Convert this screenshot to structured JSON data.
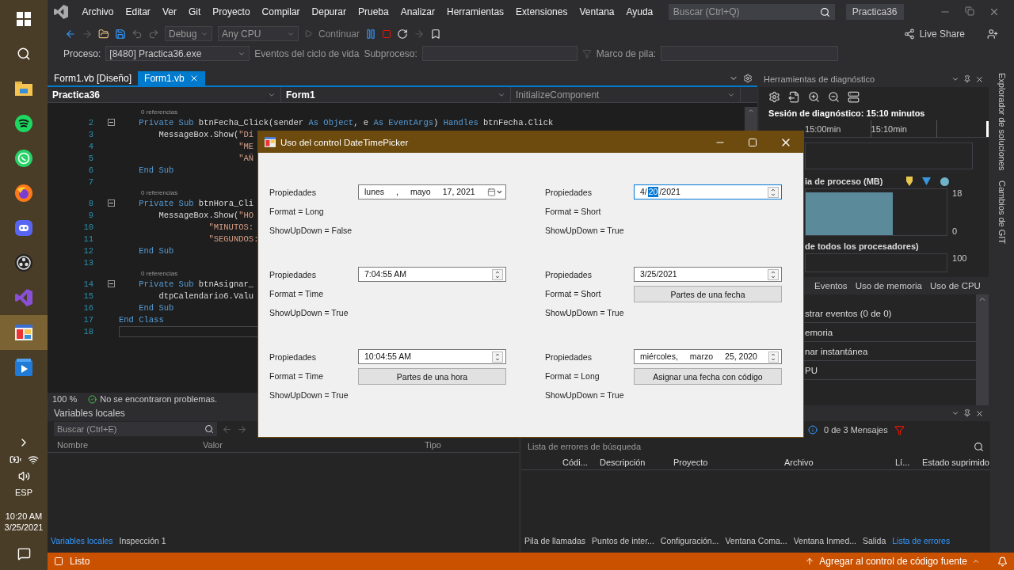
{
  "taskbar": {
    "apps": [
      {
        "kind": "start",
        "selected": false
      },
      {
        "kind": "search",
        "selected": false
      },
      {
        "kind": "folder",
        "selected": false
      },
      {
        "kind": "music",
        "selected": false
      },
      {
        "kind": "chat",
        "selected": false
      },
      {
        "kind": "browser",
        "selected": false
      },
      {
        "kind": "voice",
        "selected": false
      },
      {
        "kind": "recorder",
        "selected": false
      },
      {
        "kind": "ide",
        "selected": false
      },
      {
        "kind": "form-app",
        "selected": true
      },
      {
        "kind": "player",
        "selected": false
      }
    ],
    "language": "ESP",
    "time": "10:20 AM",
    "date": "3/25/2021"
  },
  "menu": [
    "Archivo",
    "Editar",
    "Ver",
    "Git",
    "Proyecto",
    "Compilar",
    "Depurar",
    "Prueba",
    "Analizar",
    "Herramientas",
    "Extensiones",
    "Ventana",
    "Ayuda"
  ],
  "search": {
    "placeholder": "Buscar (Ctrl+Q)"
  },
  "solution_name": "Practica36",
  "toolbar": {
    "configuration": "Debug",
    "platform": "Any CPU",
    "continue": "Continuar",
    "live_share": "Live Share"
  },
  "process_bar": {
    "label": "Proceso:",
    "process": "[8480] Practica36.exe",
    "lifecycle": "Eventos del ciclo de vida",
    "thread_label": "Subproceso:",
    "stack_label": "Marco de pila:"
  },
  "doc_tabs": [
    {
      "label": "Form1.vb [Diseño]",
      "selected": false
    },
    {
      "label": "Form1.vb",
      "selected": true
    }
  ],
  "nav_bar": {
    "project": "Practica36",
    "type": "Form1",
    "member": "InitializeComponent"
  },
  "code_lines": [
    {
      "kind": "lens",
      "text": "0 referencias",
      "fold": false,
      "current": false
    },
    {
      "kind": "code",
      "n": "2",
      "fold": true,
      "current": false,
      "tokens": [
        {
          "text": "    Private Sub ",
          "kind": "kw"
        },
        {
          "text": "btnFecha_Click(sender ",
          "kind": "p"
        },
        {
          "text": "As Object",
          "kind": "kw"
        },
        {
          "text": ", e ",
          "kind": "p"
        },
        {
          "text": "As EventArgs",
          "kind": "kw"
        },
        {
          "text": ") ",
          "kind": "p"
        },
        {
          "text": "Handles",
          "kind": "kw"
        },
        {
          "text": " btnFecha.Click",
          "kind": "p"
        }
      ]
    },
    {
      "kind": "code",
      "n": "3",
      "fold": false,
      "current": false,
      "tokens": [
        {
          "text": "        MessageBox.Show(",
          "kind": "p"
        },
        {
          "text": "\"Dí",
          "kind": "str"
        }
      ]
    },
    {
      "kind": "code",
      "n": "4",
      "fold": false,
      "current": false,
      "tokens": [
        {
          "text": "                        \"ME",
          "kind": "str"
        }
      ]
    },
    {
      "kind": "code",
      "n": "5",
      "fold": false,
      "current": false,
      "tokens": [
        {
          "text": "                        \"AÑ",
          "kind": "str"
        }
      ]
    },
    {
      "kind": "code",
      "n": "6",
      "fold": false,
      "current": false,
      "tokens": [
        {
          "text": "    End Sub",
          "kind": "kw"
        }
      ]
    },
    {
      "kind": "code",
      "n": "7",
      "fold": false,
      "current": false
    },
    {
      "kind": "lens",
      "text": "0 referencias",
      "fold": false,
      "current": false
    },
    {
      "kind": "code",
      "n": "8",
      "fold": true,
      "current": false,
      "tokens": [
        {
          "text": "    Private Sub ",
          "kind": "kw"
        },
        {
          "text": "btnHora_Cli",
          "kind": "p"
        }
      ]
    },
    {
      "kind": "code",
      "n": "9",
      "fold": false,
      "current": false,
      "tokens": [
        {
          "text": "        MessageBox.Show(",
          "kind": "p"
        },
        {
          "text": "\"HO",
          "kind": "str"
        }
      ]
    },
    {
      "kind": "code",
      "n": "10",
      "fold": false,
      "current": false,
      "tokens": [
        {
          "text": "                  \"MINUTOS:",
          "kind": "str"
        }
      ]
    },
    {
      "kind": "code",
      "n": "11",
      "fold": false,
      "current": false,
      "tokens": [
        {
          "text": "                  \"SEGUNDOS:",
          "kind": "str"
        }
      ]
    },
    {
      "kind": "code",
      "n": "12",
      "fold": false,
      "current": false,
      "tokens": [
        {
          "text": "    End Sub",
          "kind": "kw"
        }
      ]
    },
    {
      "kind": "code",
      "n": "13",
      "fold": false,
      "current": false
    },
    {
      "kind": "lens",
      "text": "0 referencias",
      "fold": false,
      "current": false
    },
    {
      "kind": "code",
      "n": "14",
      "fold": true,
      "current": false,
      "tokens": [
        {
          "text": "    Private Sub ",
          "kind": "kw"
        },
        {
          "text": "btnAsignar_",
          "kind": "p"
        }
      ]
    },
    {
      "kind": "code",
      "n": "15",
      "fold": false,
      "current": false,
      "tokens": [
        {
          "text": "        dtpCalendario6.Valu",
          "kind": "p"
        }
      ]
    },
    {
      "kind": "code",
      "n": "16",
      "fold": false,
      "current": false,
      "tokens": [
        {
          "text": "    End Sub",
          "kind": "kw"
        }
      ]
    },
    {
      "kind": "code",
      "n": "17",
      "fold": false,
      "current": false,
      "tokens": [
        {
          "text": "End Class",
          "kind": "kw"
        }
      ]
    },
    {
      "kind": "code",
      "n": "18",
      "fold": false,
      "current": true
    }
  ],
  "editor_status": {
    "zoom": "100 %",
    "message": "No se encontraron problemas."
  },
  "diagnostics": {
    "title": "Herramientas de diagnóstico",
    "session": "Sesión de diagnóstico: 15:10 minutos",
    "timeline": [
      "15:00min",
      "15:10min"
    ],
    "memory_title": "ia de proceso (MB)",
    "memory_max": "18",
    "memory_min": "0",
    "cpu_title": "de todos los procesadores)",
    "cpu_max": "100",
    "tabs": [
      "Eventos",
      "Uso de memoria",
      "Uso de CPU"
    ],
    "items": [
      "strar eventos (0 de 0)",
      "emoria",
      "nar instantánea",
      "PU"
    ]
  },
  "side_tabs": [
    "Explorador de soluciones",
    "Cambios de GIT"
  ],
  "locals": {
    "title": "Variables locales",
    "search": {
      "placeholder": "Buscar (Ctrl+E)"
    },
    "columns": [
      "Nombre",
      "Valor",
      "Tipo"
    ],
    "tabs": [
      {
        "label": "Variables locales",
        "selected": true
      },
      {
        "label": "Inspección 1",
        "selected": false
      }
    ]
  },
  "error_list": {
    "messages": "0 de 3 Mensajes",
    "search": {
      "placeholder": "Lista de errores de búsqueda"
    },
    "columns": [
      "Códi...",
      "Descripción",
      "Proyecto",
      "Archivo",
      "Lí...",
      "Estado suprimido"
    ],
    "tabs": [
      {
        "label": "Pila de llamadas",
        "selected": false
      },
      {
        "label": "Puntos de inter...",
        "selected": false
      },
      {
        "label": "Configuración...",
        "selected": false
      },
      {
        "label": "Ventana Coma...",
        "selected": false
      },
      {
        "label": "Ventana Inmed...",
        "selected": false
      },
      {
        "label": "Salida",
        "selected": false
      },
      {
        "label": "Lista de errores",
        "selected": true
      }
    ]
  },
  "status_bar": {
    "text": "Listo",
    "source_control": "Agregar al control de código fuente"
  },
  "dialog": {
    "title": "Uso del control DateTimePicker",
    "groups": [
      {
        "labels": [
          "Propiedades",
          "Format = Long",
          "ShowUpDown = False"
        ],
        "picker": {
          "kind": "dropdown",
          "spaced": true,
          "focused": false,
          "parts": [
            {
              "text": "lunes",
              "selected": false
            },
            {
              "text": ",",
              "selected": false
            },
            {
              "text": "mayo",
              "selected": false
            },
            {
              "text": "17, 2021",
              "selected": false
            }
          ]
        }
      },
      {
        "labels": [
          "Propiedades",
          "Format = Short",
          "ShowUpDown = True"
        ],
        "picker": {
          "kind": "updown",
          "spaced": false,
          "focused": true,
          "parts": [
            {
              "text": "4/",
              "selected": false
            },
            {
              "text": "20",
              "selected": true
            },
            {
              "text": "/2021",
              "selected": false
            }
          ]
        }
      },
      {
        "labels": [
          "Propiedades",
          "Format = Time",
          "ShowUpDown = True"
        ],
        "picker": {
          "kind": "updown",
          "focused": false,
          "parts": [
            {
              "text": "7:04:55 AM",
              "selected": false
            }
          ]
        }
      },
      {
        "labels": [
          "Propiedades",
          "Format = Short",
          "ShowUpDown = True"
        ],
        "picker": {
          "kind": "updown",
          "focused": false,
          "parts": [
            {
              "text": "3/25/2021",
              "selected": false
            }
          ]
        },
        "button": "Partes de una fecha"
      },
      {
        "labels": [
          "Propiedades",
          "Format = Time",
          "ShowUpDown = True"
        ],
        "picker": {
          "kind": "updown",
          "focused": false,
          "parts": [
            {
              "text": "10:04:55 AM",
              "selected": false
            }
          ]
        },
        "button": "Partes de una hora"
      },
      {
        "labels": [
          "Propiedades",
          "Format = Long",
          "ShowUpDown = True"
        ],
        "picker": {
          "kind": "updown",
          "spaced": true,
          "focused": false,
          "parts": [
            {
              "text": "miércoles,",
              "selected": false
            },
            {
              "text": "marzo",
              "selected": false
            },
            {
              "text": "25, 2020",
              "selected": false
            }
          ]
        },
        "button": "Asignar una fecha con código"
      }
    ]
  }
}
